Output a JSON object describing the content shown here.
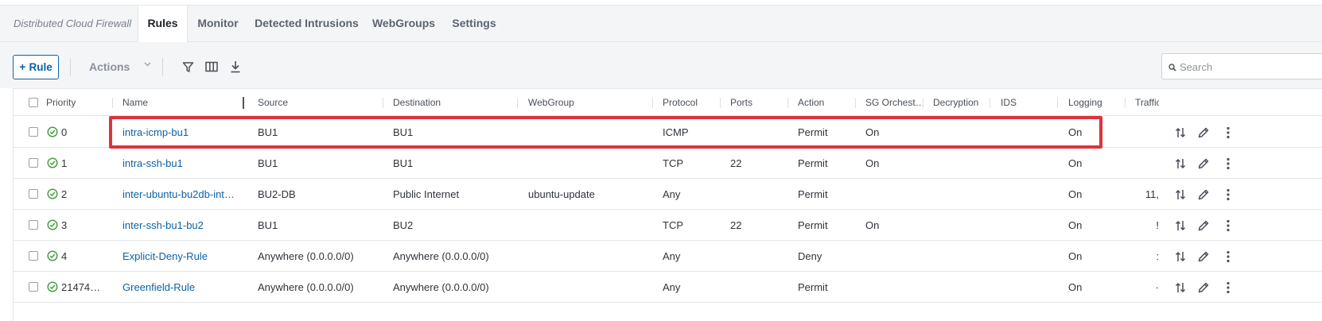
{
  "tabs": {
    "app_title": "Distributed Cloud Firewall",
    "items": [
      "Rules",
      "Monitor",
      "Detected Intrusions",
      "WebGroups",
      "Settings"
    ],
    "active": "Rules"
  },
  "toolbar": {
    "add_rule_label": "Rule",
    "actions_label": "Actions",
    "search_placeholder": "Search"
  },
  "table": {
    "columns": [
      "Priority",
      "Name",
      "Source",
      "Destination",
      "WebGroup",
      "Protocol",
      "Ports",
      "Action",
      "SG Orchest…",
      "Decryption",
      "IDS",
      "Logging",
      "Traffic"
    ],
    "rows": [
      {
        "priority": "0",
        "name": "intra-icmp-bu1",
        "source": "BU1",
        "destination": "BU1",
        "webgroup": "",
        "protocol": "ICMP",
        "ports": "",
        "action": "Permit",
        "sg": "On",
        "decryption": "",
        "ids": "",
        "logging": "On",
        "traffic": ""
      },
      {
        "priority": "1",
        "name": "intra-ssh-bu1",
        "source": "BU1",
        "destination": "BU1",
        "webgroup": "",
        "protocol": "TCP",
        "ports": "22",
        "action": "Permit",
        "sg": "On",
        "decryption": "",
        "ids": "",
        "logging": "On",
        "traffic": ""
      },
      {
        "priority": "2",
        "name": "inter-ubuntu-bu2db-int…",
        "source": "BU2-DB",
        "destination": "Public Internet",
        "webgroup": "ubuntu-update",
        "protocol": "Any",
        "ports": "",
        "action": "Permit",
        "sg": "",
        "decryption": "",
        "ids": "",
        "logging": "On",
        "traffic": "11,"
      },
      {
        "priority": "3",
        "name": "inter-ssh-bu1-bu2",
        "source": "BU1",
        "destination": "BU2",
        "webgroup": "",
        "protocol": "TCP",
        "ports": "22",
        "action": "Permit",
        "sg": "On",
        "decryption": "",
        "ids": "",
        "logging": "On",
        "traffic": "!"
      },
      {
        "priority": "4",
        "name": "Explicit-Deny-Rule",
        "source": "Anywhere (0.0.0.0/0)",
        "destination": "Anywhere (0.0.0.0/0)",
        "webgroup": "",
        "protocol": "Any",
        "ports": "",
        "action": "Deny",
        "sg": "",
        "decryption": "",
        "ids": "",
        "logging": "On",
        "traffic": ":"
      },
      {
        "priority": "21474…",
        "name": "Greenfield-Rule",
        "source": "Anywhere (0.0.0.0/0)",
        "destination": "Anywhere (0.0.0.0/0)",
        "webgroup": "",
        "protocol": "Any",
        "ports": "",
        "action": "Permit",
        "sg": "",
        "decryption": "",
        "ids": "",
        "logging": "On",
        "traffic": "·"
      }
    ]
  },
  "icons": {
    "add": "plus-icon",
    "filter": "filter-icon",
    "columns": "columns-icon",
    "export": "download-icon",
    "search": "search-icon",
    "status": "check-circle-icon",
    "move": "reorder-arrows-icon",
    "edit": "pencil-icon",
    "more": "kebab-menu-icon"
  },
  "colors": {
    "accent": "#0b62a8",
    "status_ok": "#3f9a3a",
    "highlight": "#e0323c"
  }
}
